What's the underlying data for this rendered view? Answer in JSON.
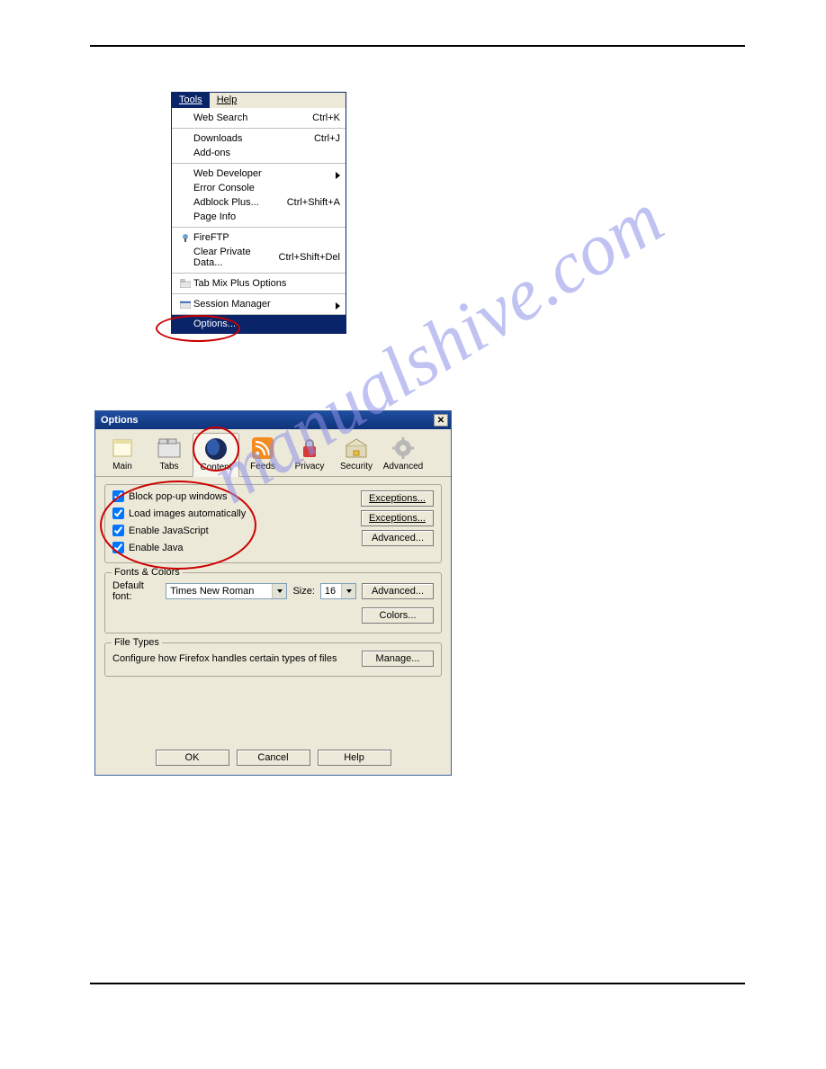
{
  "watermark": "manualshive.com",
  "menu": {
    "tabs": {
      "tools": "Tools",
      "help": "Help"
    },
    "sections": [
      [
        {
          "label": "Web Search",
          "shortcut": "Ctrl+K",
          "u": "S"
        }
      ],
      [
        {
          "label": "Downloads",
          "shortcut": "Ctrl+J",
          "u": "D"
        },
        {
          "label": "Add-ons",
          "u": "A"
        }
      ],
      [
        {
          "label": "Web Developer",
          "submenu": true
        },
        {
          "label": "Error Console",
          "u": "C"
        },
        {
          "label": "Adblock Plus...",
          "shortcut": "Ctrl+Shift+A"
        },
        {
          "label": "Page Info",
          "u": "I"
        }
      ],
      [
        {
          "label": "FireFTP",
          "u": "F",
          "icon": "fireftp"
        },
        {
          "label": "Clear Private Data...",
          "shortcut": "Ctrl+Shift+Del"
        }
      ],
      [
        {
          "label": "Tab Mix Plus Options",
          "icon": "tabmix"
        }
      ],
      [
        {
          "label": "Session Manager",
          "submenu": true,
          "icon": "session"
        }
      ],
      [
        {
          "label": "Options...",
          "u": "O",
          "highlight": true
        }
      ]
    ]
  },
  "dialog": {
    "title": "Options",
    "tabs": [
      "Main",
      "Tabs",
      "Content",
      "Feeds",
      "Privacy",
      "Security",
      "Advanced"
    ],
    "selected_tab": "Content",
    "content": {
      "checks": [
        {
          "label": "Block pop-up windows",
          "checked": true,
          "u": "B"
        },
        {
          "label": "Load images automatically",
          "checked": true
        },
        {
          "label": "Enable JavaScript",
          "checked": true,
          "u": "J"
        },
        {
          "label": "Enable Java",
          "checked": true,
          "u": "v"
        }
      ],
      "right_buttons": [
        "Exceptions...",
        "Exceptions...",
        "Advanced..."
      ],
      "fonts_label": "Fonts & Colors",
      "default_font_label": "Default font:",
      "default_font_value": "Times New Roman",
      "size_label": "Size:",
      "size_value": "16",
      "advanced_btn": "Advanced...",
      "colors_btn": "Colors...",
      "file_types_label": "File Types",
      "file_types_text": "Configure how Firefox handles certain types of files",
      "manage_btn": "Manage..."
    },
    "buttons": {
      "ok": "OK",
      "cancel": "Cancel",
      "help": "Help"
    }
  }
}
